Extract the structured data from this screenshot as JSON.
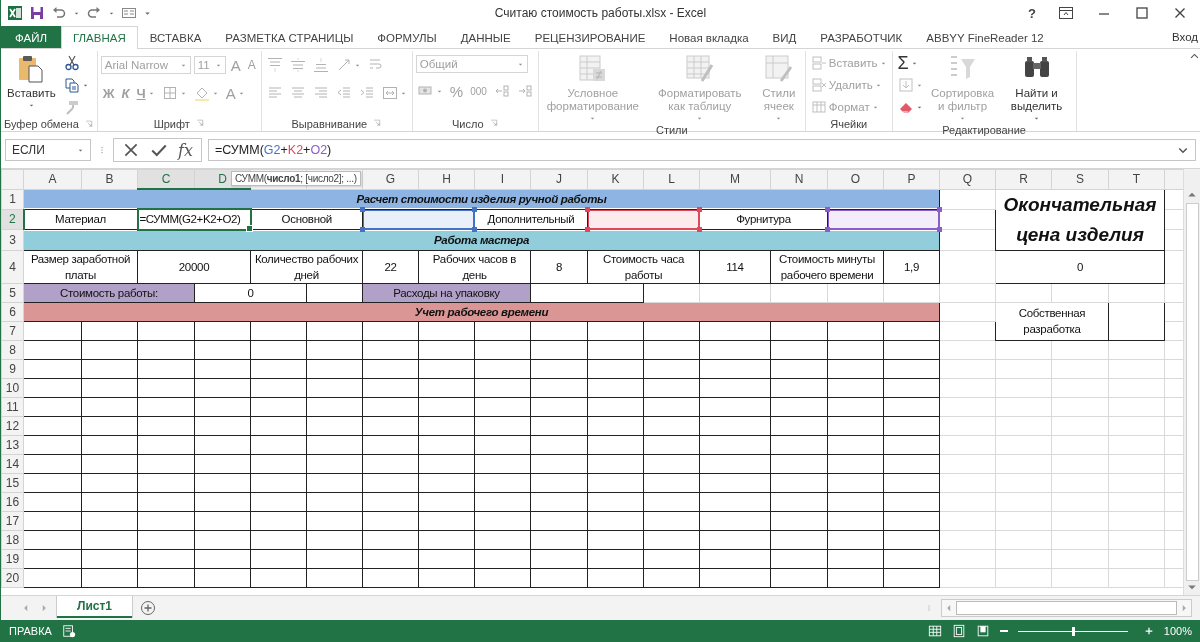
{
  "window": {
    "title": "Считаю стоимость работы.xlsx - Excel",
    "help": "?"
  },
  "tabs": [
    {
      "label": "ФАЙЛ",
      "kind": "file",
      "selected": false
    },
    {
      "label": "ГЛАВНАЯ",
      "kind": "tab",
      "selected": true
    },
    {
      "label": "ВСТАВКА",
      "kind": "tab",
      "selected": false
    },
    {
      "label": "РАЗМЕТКА СТРАНИЦЫ",
      "kind": "tab",
      "selected": false
    },
    {
      "label": "ФОРМУЛЫ",
      "kind": "tab",
      "selected": false
    },
    {
      "label": "ДАННЫЕ",
      "kind": "tab",
      "selected": false
    },
    {
      "label": "РЕЦЕНЗИРОВАНИЕ",
      "kind": "tab",
      "selected": false
    },
    {
      "label": "Новая вкладка",
      "kind": "tab",
      "selected": false
    },
    {
      "label": "ВИД",
      "kind": "tab",
      "selected": false
    },
    {
      "label": "РАЗРАБОТЧИК",
      "kind": "tab",
      "selected": false
    },
    {
      "label": "ABBYY FineReader 12",
      "kind": "tab",
      "selected": false
    }
  ],
  "account": {
    "label": "Вход"
  },
  "ribbon": {
    "groups": [
      {
        "label": "Буфер обмена",
        "launcher": true,
        "columns": [
          {
            "kind": "large",
            "control": {
              "kind": "paste",
              "label": "Вставить",
              "dropdown": true,
              "disabled": false
            }
          },
          {
            "kind": "stack",
            "rows": [
              {
                "controls": [
                  {
                    "kind": "cut",
                    "disabled": false
                  }
                ]
              },
              {
                "controls": [
                  {
                    "kind": "copy",
                    "dropdown": true,
                    "disabled": false
                  }
                ]
              },
              {
                "controls": [
                  {
                    "kind": "painter",
                    "disabled": true
                  }
                ]
              }
            ]
          }
        ]
      },
      {
        "label": "Шрифт",
        "launcher": true,
        "columns": [
          {
            "kind": "stack",
            "rows": [
              {
                "controls": [
                  {
                    "kind": "font",
                    "text": "Arial Narrow",
                    "disabled": true
                  },
                  {
                    "kind": "size",
                    "text": "11",
                    "disabled": true
                  },
                  {
                    "kind": "grow",
                    "text": "A",
                    "disabled": true
                  },
                  {
                    "kind": "shrink",
                    "text": "A",
                    "disabled": true
                  }
                ]
              },
              {
                "controls": [
                  {
                    "kind": "bold",
                    "text": "Ж",
                    "disabled": true
                  },
                  {
                    "kind": "italic",
                    "text": "К",
                    "disabled": true
                  },
                  {
                    "kind": "underline",
                    "text": "Ч",
                    "dropdown": true,
                    "disabled": true
                  },
                  {
                    "kind": "borders",
                    "dropdown": true,
                    "disabled": true
                  },
                  {
                    "kind": "fillcolor",
                    "dropdown": true,
                    "disabled": true
                  },
                  {
                    "kind": "fontcolor",
                    "text": "A",
                    "dropdown": true,
                    "disabled": true
                  }
                ]
              }
            ]
          }
        ]
      },
      {
        "label": "Выравнивание",
        "launcher": true,
        "columns": [
          {
            "kind": "stack",
            "rows": [
              {
                "controls": [
                  {
                    "kind": "atop",
                    "disabled": true
                  },
                  {
                    "kind": "amid",
                    "disabled": true
                  },
                  {
                    "kind": "abot",
                    "disabled": true
                  },
                  {
                    "kind": "orient",
                    "dropdown": true,
                    "disabled": true
                  },
                  {
                    "kind": "wrap",
                    "disabled": true
                  }
                ]
              },
              {
                "controls": [
                  {
                    "kind": "aleft",
                    "disabled": true
                  },
                  {
                    "kind": "acenter",
                    "disabled": true
                  },
                  {
                    "kind": "aright",
                    "disabled": true
                  },
                  {
                    "kind": "outdent",
                    "disabled": true
                  },
                  {
                    "kind": "indent",
                    "disabled": true
                  },
                  {
                    "kind": "merge",
                    "dropdown": true,
                    "disabled": true
                  }
                ]
              }
            ]
          }
        ]
      },
      {
        "label": "Число",
        "launcher": true,
        "columns": [
          {
            "kind": "stack",
            "rows": [
              {
                "controls": [
                  {
                    "kind": "numfmt",
                    "text": "Общий",
                    "disabled": true
                  }
                ]
              },
              {
                "controls": [
                  {
                    "kind": "currency",
                    "dropdown": true,
                    "disabled": true
                  },
                  {
                    "kind": "percent",
                    "text": "%",
                    "disabled": true
                  },
                  {
                    "kind": "thousands",
                    "text": "000",
                    "disabled": true
                  },
                  {
                    "kind": "incdec",
                    "disabled": true
                  },
                  {
                    "kind": "decdec",
                    "disabled": true
                  }
                ]
              }
            ]
          }
        ]
      },
      {
        "label": "Стили",
        "launcher": false,
        "columns": [
          {
            "kind": "large",
            "control": {
              "kind": "condfmt",
              "label": "Условное форматирование",
              "dropdown": true,
              "disabled": true
            }
          },
          {
            "kind": "large",
            "control": {
              "kind": "tablefmt",
              "label": "Форматировать как таблицу",
              "dropdown": true,
              "disabled": true
            }
          },
          {
            "kind": "large",
            "control": {
              "kind": "cellstyles",
              "label": "Стили ячеек",
              "dropdown": true,
              "disabled": true
            }
          }
        ]
      },
      {
        "label": "Ячейки",
        "launcher": false,
        "columns": [
          {
            "kind": "stack",
            "rows": [
              {
                "controls": [
                  {
                    "kind": "cinsert",
                    "label": "Вставить",
                    "dropdown": true,
                    "disabled": true
                  }
                ]
              },
              {
                "controls": [
                  {
                    "kind": "cdelete",
                    "label": "Удалить",
                    "dropdown": true,
                    "disabled": true
                  }
                ]
              },
              {
                "controls": [
                  {
                    "kind": "cformat",
                    "label": "Формат",
                    "dropdown": true,
                    "disabled": true
                  }
                ]
              }
            ]
          }
        ]
      },
      {
        "label": "Редактирование",
        "launcher": false,
        "columns": [
          {
            "kind": "stack",
            "rows": [
              {
                "controls": [
                  {
                    "kind": "autosum",
                    "text": "Σ",
                    "dropdown": true,
                    "disabled": false
                  }
                ]
              },
              {
                "controls": [
                  {
                    "kind": "filldown",
                    "dropdown": true,
                    "disabled": true
                  }
                ]
              },
              {
                "controls": [
                  {
                    "kind": "clear",
                    "dropdown": true,
                    "disabled": false
                  }
                ]
              }
            ]
          },
          {
            "kind": "large",
            "control": {
              "kind": "sort",
              "label": "Сортировка и фильтр",
              "dropdown": true,
              "disabled": true
            }
          },
          {
            "kind": "large",
            "control": {
              "kind": "find",
              "label": "Найти и выделить",
              "dropdown": true,
              "disabled": false
            }
          }
        ]
      }
    ]
  },
  "formula_bar": {
    "name_box": "ЕСЛИ",
    "function_button": "fx",
    "formula": [
      {
        "text": "=СУММ("
      },
      {
        "text": "G2",
        "color": "#4472c4"
      },
      {
        "text": "+"
      },
      {
        "text": "K2",
        "color": "#e0475a"
      },
      {
        "text": "+"
      },
      {
        "text": "O2",
        "color": "#8a5ccc"
      },
      {
        "text": ")"
      }
    ]
  },
  "sheet": {
    "tooltip": "СУММ(**число1**; [число2]; ...)",
    "columns": [
      {
        "label": "A",
        "selected": false
      },
      {
        "label": "B",
        "selected": false
      },
      {
        "label": "C",
        "selected": true
      },
      {
        "label": "D",
        "selected": true
      },
      {
        "selected": false
      },
      {
        "selected": false
      },
      {
        "label": "G",
        "selected": false
      },
      {
        "label": "H",
        "selected": false
      },
      {
        "label": "I",
        "selected": false
      },
      {
        "label": "J",
        "selected": false
      },
      {
        "label": "K",
        "selected": false
      },
      {
        "label": "L",
        "selected": false
      },
      {
        "label": "M",
        "selected": false
      },
      {
        "label": "N",
        "selected": false
      },
      {
        "label": "O",
        "selected": false
      },
      {
        "label": "P",
        "selected": false
      },
      {
        "label": "Q",
        "selected": false
      },
      {
        "label": "R",
        "selected": false
      },
      {
        "label": "S",
        "selected": false
      },
      {
        "label": "T",
        "selected": false
      }
    ],
    "rows": [
      {
        "number": "1",
        "selected": false,
        "kind": "form",
        "cells": [
          {
            "text": "Расчет стоимости изделия ручной работы",
            "kind": "title-blue"
          },
          {
            "kind": "grid"
          },
          {
            "text": "Окончательная цена изделия",
            "kind": "big-title"
          }
        ]
      },
      {
        "number": "2",
        "selected": true,
        "kind": "form",
        "cells": [
          {
            "text": "Материал",
            "kind": "box"
          },
          {
            "text": "=СУММ(G2+K2+O2)",
            "kind": "active"
          },
          {
            "text": "Основной",
            "kind": "box"
          },
          {
            "kind": "ref",
            "color": "#4472c4"
          },
          {
            "text": "Дополнительный",
            "kind": "box"
          },
          {
            "kind": "ref",
            "color": "#e0475a"
          },
          {
            "text": "Фурнитура",
            "kind": "box"
          },
          {
            "kind": "ref",
            "color": "#8a5ccc"
          }
        ]
      },
      {
        "number": "3",
        "selected": false,
        "kind": "form",
        "cells": [
          {
            "text": "Работа мастера",
            "kind": "title-teal"
          }
        ]
      },
      {
        "number": "4",
        "selected": false,
        "kind": "form",
        "cells": [
          {
            "text": "Размер заработной платы",
            "kind": "box"
          },
          {
            "text": "20000",
            "kind": "box"
          },
          {
            "text": "Количество рабочих дней",
            "kind": "box"
          },
          {
            "text": "22",
            "kind": "box"
          },
          {
            "text": "Рабочих часов в день",
            "kind": "box"
          },
          {
            "text": "8",
            "kind": "box"
          },
          {
            "text": "Стоимость часа работы",
            "kind": "box"
          },
          {
            "text": "114",
            "kind": "box"
          },
          {
            "text": "Стоимость минуты рабочего времени",
            "kind": "box"
          },
          {
            "text": "1,9",
            "kind": "box"
          },
          {
            "kind": "grid"
          },
          {
            "text": "0",
            "kind": "box"
          }
        ]
      },
      {
        "number": "5",
        "selected": false,
        "kind": "form",
        "cells": [
          {
            "text": "Стоимость работы:",
            "kind": "label-purple"
          },
          {
            "text": "0",
            "kind": "box"
          },
          {
            "kind": "box"
          },
          {
            "text": "Расходы на упаковку",
            "kind": "label-purple"
          },
          {
            "kind": "box"
          }
        ]
      },
      {
        "number": "6",
        "selected": false,
        "kind": "form",
        "cells": [
          {
            "text": "Учет рабочего времени",
            "kind": "title-red"
          },
          {
            "kind": "grid"
          },
          {
            "text": "Собственная разработка",
            "kind": "box"
          },
          {
            "kind": "box"
          }
        ]
      },
      {
        "number": "7",
        "selected": false,
        "kind": "log"
      },
      {
        "number": "8",
        "selected": false,
        "kind": "log"
      },
      {
        "number": "9",
        "selected": false,
        "kind": "log"
      },
      {
        "number": "10",
        "selected": false,
        "kind": "log"
      },
      {
        "number": "11",
        "selected": false,
        "kind": "log"
      },
      {
        "number": "12",
        "selected": false,
        "kind": "log"
      },
      {
        "number": "13",
        "selected": false,
        "kind": "log"
      },
      {
        "number": "14",
        "selected": false,
        "kind": "log"
      },
      {
        "number": "15",
        "selected": false,
        "kind": "log"
      },
      {
        "number": "16",
        "selected": false,
        "kind": "log"
      },
      {
        "number": "17",
        "selected": false,
        "kind": "log"
      },
      {
        "number": "18",
        "selected": false,
        "kind": "log"
      },
      {
        "number": "19",
        "selected": false,
        "kind": "log"
      },
      {
        "number": "20",
        "selected": false,
        "kind": "log"
      }
    ]
  },
  "sheet_tabs": [
    {
      "label": "Лист1",
      "selected": true
    }
  ],
  "status_bar": {
    "mode": "ПРАВКА",
    "zoom": {
      "level": 0.5,
      "reading": "100%"
    }
  }
}
